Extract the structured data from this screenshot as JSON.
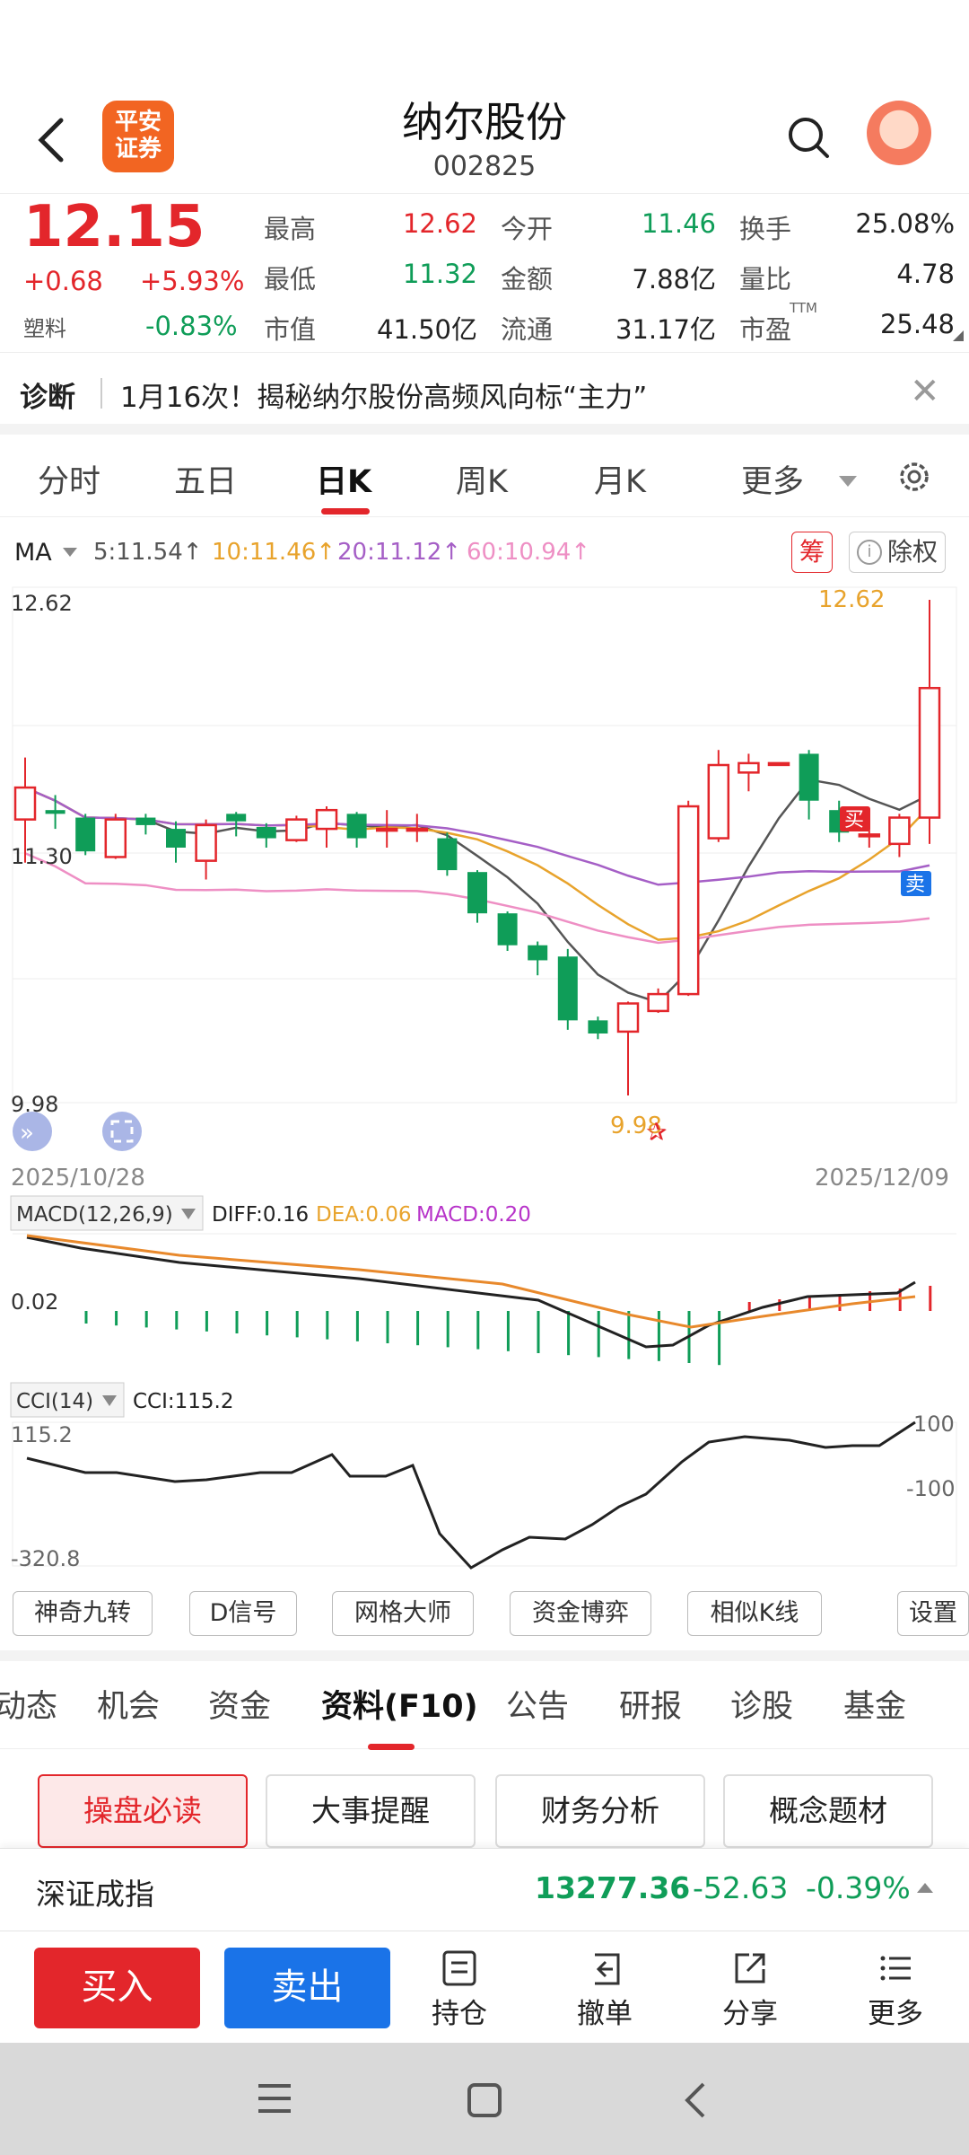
{
  "header": {
    "logo_line1": "平安",
    "logo_line2": "证券",
    "name": "纳尔股份",
    "code": "002825"
  },
  "quote": {
    "price": "12.15",
    "change": "+0.68",
    "change_pct": "+5.93%",
    "sector": "塑料",
    "sector_pct": "-0.83%",
    "cells": [
      {
        "label": "最高",
        "value": "12.62"
      },
      {
        "label": "今开",
        "value": "11.46"
      },
      {
        "label": "换手",
        "value": "25.08%"
      },
      {
        "label": "最低",
        "value": "11.32"
      },
      {
        "label": "金额",
        "value": "7.88亿"
      },
      {
        "label": "量比",
        "value": "4.78"
      },
      {
        "label": "市值",
        "value": "41.50亿"
      },
      {
        "label": "流通",
        "value": "31.17亿"
      },
      {
        "label": "市盈",
        "value": "25.48"
      }
    ],
    "pe_sup": "TTM"
  },
  "diag": {
    "label": "诊断",
    "text": "1月16次！揭秘纳尔股份高频风向标“主力”"
  },
  "kline_tabs": [
    "分时",
    "五日",
    "日K",
    "周K",
    "月K",
    "更多"
  ],
  "ma": {
    "label": "MA",
    "ma5": "5:11.54↑",
    "ma10": "10:11.46↑",
    "ma20": "20:11.12↑",
    "ma60": "60:10.94↑",
    "colors": {
      "ma5": "#555555",
      "ma10": "#e8a32c",
      "ma20": "#a55fc6",
      "ma60": "#ee8fc4"
    },
    "chip_label": "筹",
    "exright_label": "除权"
  },
  "chart_data": [
    {
      "type": "candlestick",
      "title": "日K",
      "y_labels": [
        "12.62",
        "11.30",
        "9.98"
      ],
      "high_marker": "12.62",
      "low_marker": "9.98",
      "date_start": "2025/10/28",
      "date_end": "2025/12/09",
      "buy_label": "买",
      "sell_label": "卖",
      "candles": [
        {
          "o": 11.45,
          "c": 11.62,
          "h": 11.78,
          "l": 11.22
        },
        {
          "o": 11.5,
          "c": 11.48,
          "h": 11.58,
          "l": 11.4
        },
        {
          "o": 11.46,
          "c": 11.28,
          "h": 11.48,
          "l": 11.26
        },
        {
          "o": 11.25,
          "c": 11.45,
          "h": 11.48,
          "l": 11.24
        },
        {
          "o": 11.46,
          "c": 11.42,
          "h": 11.48,
          "l": 11.37
        },
        {
          "o": 11.4,
          "c": 11.3,
          "h": 11.44,
          "l": 11.22
        },
        {
          "o": 11.23,
          "c": 11.42,
          "h": 11.45,
          "l": 11.13
        },
        {
          "o": 11.48,
          "c": 11.44,
          "h": 11.49,
          "l": 11.36
        },
        {
          "o": 11.41,
          "c": 11.35,
          "h": 11.43,
          "l": 11.3
        },
        {
          "o": 11.34,
          "c": 11.45,
          "h": 11.47,
          "l": 11.33
        },
        {
          "o": 11.4,
          "c": 11.5,
          "h": 11.52,
          "l": 11.3
        },
        {
          "o": 11.48,
          "c": 11.35,
          "h": 11.49,
          "l": 11.3
        },
        {
          "o": 11.4,
          "c": 11.4,
          "h": 11.5,
          "l": 11.3
        },
        {
          "o": 11.4,
          "c": 11.4,
          "h": 11.48,
          "l": 11.33
        },
        {
          "o": 11.35,
          "c": 11.18,
          "h": 11.38,
          "l": 11.15
        },
        {
          "o": 11.17,
          "c": 10.95,
          "h": 11.18,
          "l": 10.9
        },
        {
          "o": 10.95,
          "c": 10.78,
          "h": 10.96,
          "l": 10.75
        },
        {
          "o": 10.78,
          "c": 10.7,
          "h": 10.8,
          "l": 10.62
        },
        {
          "o": 10.72,
          "c": 10.38,
          "h": 10.76,
          "l": 10.33
        },
        {
          "o": 10.38,
          "c": 10.31,
          "h": 10.4,
          "l": 10.28
        },
        {
          "o": 10.32,
          "c": 10.47,
          "h": 10.48,
          "l": 9.98
        },
        {
          "o": 10.43,
          "c": 10.52,
          "h": 10.55,
          "l": 10.42
        },
        {
          "o": 10.52,
          "c": 11.52,
          "h": 11.55,
          "l": 10.51
        },
        {
          "o": 11.35,
          "c": 11.74,
          "h": 11.82,
          "l": 11.33
        },
        {
          "o": 11.7,
          "c": 11.75,
          "h": 11.8,
          "l": 11.6
        },
        {
          "o": 11.75,
          "c": 11.75,
          "h": 11.75,
          "l": 11.75
        },
        {
          "o": 11.8,
          "c": 11.55,
          "h": 11.82,
          "l": 11.45
        },
        {
          "o": 11.5,
          "c": 11.38,
          "h": 11.55,
          "l": 11.33
        },
        {
          "o": 11.37,
          "c": 11.37,
          "h": 11.4,
          "l": 11.3
        },
        {
          "o": 11.32,
          "c": 11.46,
          "h": 11.48,
          "l": 11.25
        },
        {
          "o": 11.46,
          "c": 12.15,
          "h": 12.62,
          "l": 11.32
        }
      ]
    },
    {
      "type": "macd",
      "label": "MACD(12,26,9)",
      "diff": "DIFF:0.16",
      "dea": "DEA:0.06",
      "macd": "MACD:0.20",
      "zero_label": "0.02"
    },
    {
      "type": "cci",
      "label": "CCI(14)",
      "value": "CCI:115.2",
      "y_labels": [
        "115.2",
        "-320.8"
      ],
      "ref_labels": [
        "100",
        "-100"
      ]
    }
  ],
  "tools": [
    "神奇九转",
    "D信号",
    "网格大师",
    "资金博弈",
    "相似K线",
    "设置"
  ],
  "f10_tabs": [
    "动态",
    "机会",
    "资金",
    "资料(F10)",
    "公告",
    "研报",
    "诊股",
    "基金"
  ],
  "f10_subtabs": [
    "操盘必读",
    "大事提醒",
    "财务分析",
    "概念题材"
  ],
  "index": {
    "name": "深证成指",
    "value": "13277.36",
    "change": "-52.63",
    "pct": "-0.39%"
  },
  "actions": {
    "buy": "买入",
    "sell": "卖出",
    "items": [
      "持仓",
      "撤单",
      "分享",
      "更多"
    ]
  }
}
